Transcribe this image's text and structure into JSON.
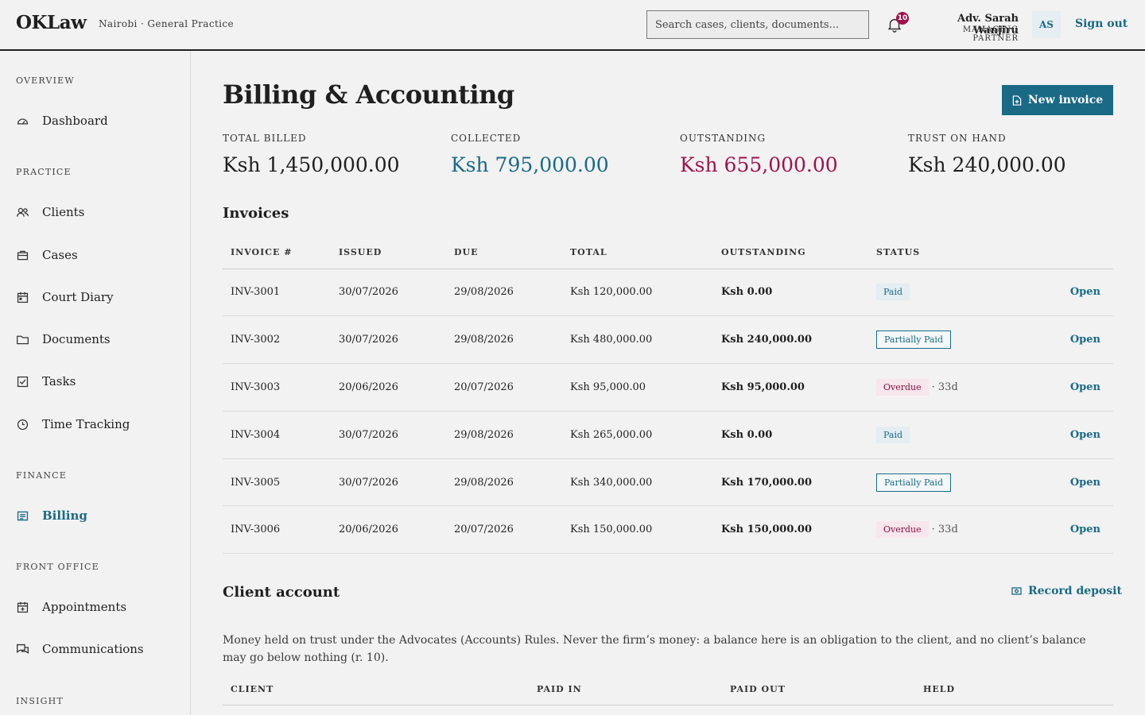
{
  "header": {
    "brand": "OKLaw",
    "firm": "Nairobi · General Practice",
    "search_placeholder": "Search cases, clients, documents...",
    "notifications_count": "10",
    "user_name": "Adv. Sarah Wanjiru",
    "user_role": "MANAGING PARTNER",
    "avatar_initials": "AS",
    "sign_out": "Sign out"
  },
  "sidebar": {
    "sections": [
      {
        "title": "OVERVIEW"
      },
      {
        "title": "PRACTICE"
      },
      {
        "title": "FINANCE"
      },
      {
        "title": "FRONT OFFICE"
      },
      {
        "title": "INSIGHT"
      }
    ],
    "items": {
      "dashboard": {
        "label": "Dashboard",
        "icon": "gauge-icon"
      },
      "clients": {
        "label": "Clients",
        "icon": "people-icon"
      },
      "cases": {
        "label": "Cases",
        "icon": "briefcase-icon"
      },
      "court_diary": {
        "label": "Court Diary",
        "icon": "calendar-icon"
      },
      "documents": {
        "label": "Documents",
        "icon": "folder-icon"
      },
      "tasks": {
        "label": "Tasks",
        "icon": "checkbox-icon"
      },
      "time_tracking": {
        "label": "Time Tracking",
        "icon": "clock-icon"
      },
      "billing": {
        "label": "Billing",
        "icon": "receipt-icon",
        "active": true
      },
      "appointments": {
        "label": "Appointments",
        "icon": "calendar-plus-icon"
      },
      "communications": {
        "label": "Communications",
        "icon": "chat-icon"
      }
    }
  },
  "page": {
    "title": "Billing & Accounting",
    "new_invoice": "New invoice"
  },
  "stats": [
    {
      "label": "TOTAL BILLED",
      "value": "Ksh 1,450,000.00",
      "color": "#1f1f1f"
    },
    {
      "label": "COLLECTED",
      "value": "Ksh 795,000.00",
      "color": "#1a6a86"
    },
    {
      "label": "OUTSTANDING",
      "value": "Ksh 655,000.00",
      "color": "#a0124c"
    },
    {
      "label": "TRUST ON HAND",
      "value": "Ksh 240,000.00",
      "color": "#1f1f1f"
    }
  ],
  "invoices": {
    "title": "Invoices",
    "columns": [
      "INVOICE #",
      "ISSUED",
      "DUE",
      "TOTAL",
      "OUTSTANDING",
      "STATUS"
    ],
    "rows": [
      {
        "number": "INV-3001",
        "issued": "30/07/2026",
        "due": "29/08/2026",
        "total": "Ksh 120,000.00",
        "outstanding": "Ksh 0.00",
        "status": "Paid",
        "age": "",
        "action": "Open"
      },
      {
        "number": "INV-3002",
        "issued": "30/07/2026",
        "due": "29/08/2026",
        "total": "Ksh 480,000.00",
        "outstanding": "Ksh 240,000.00",
        "status": "Partially Paid",
        "age": "",
        "action": "Open"
      },
      {
        "number": "INV-3003",
        "issued": "20/06/2026",
        "due": "20/07/2026",
        "total": "Ksh 95,000.00",
        "outstanding": "Ksh 95,000.00",
        "status": "Overdue",
        "age": "· 33d",
        "action": "Open"
      },
      {
        "number": "INV-3004",
        "issued": "30/07/2026",
        "due": "29/08/2026",
        "total": "Ksh 265,000.00",
        "outstanding": "Ksh 0.00",
        "status": "Paid",
        "age": "",
        "action": "Open"
      },
      {
        "number": "INV-3005",
        "issued": "30/07/2026",
        "due": "29/08/2026",
        "total": "Ksh 340,000.00",
        "outstanding": "Ksh 170,000.00",
        "status": "Partially Paid",
        "age": "",
        "action": "Open"
      },
      {
        "number": "INV-3006",
        "issued": "20/06/2026",
        "due": "20/07/2026",
        "total": "Ksh 150,000.00",
        "outstanding": "Ksh 150,000.00",
        "status": "Overdue",
        "age": "· 33d",
        "action": "Open"
      }
    ]
  },
  "client_account": {
    "title": "Client account",
    "record_deposit": "Record deposit",
    "note": "Money held on trust under the Advocates (Accounts) Rules. Never the firm’s money: a balance here is an obligation to the client, and no client’s balance may go below nothing (r. 10).",
    "columns": [
      "CLIENT",
      "PAID IN",
      "PAID OUT",
      "HELD"
    ]
  }
}
